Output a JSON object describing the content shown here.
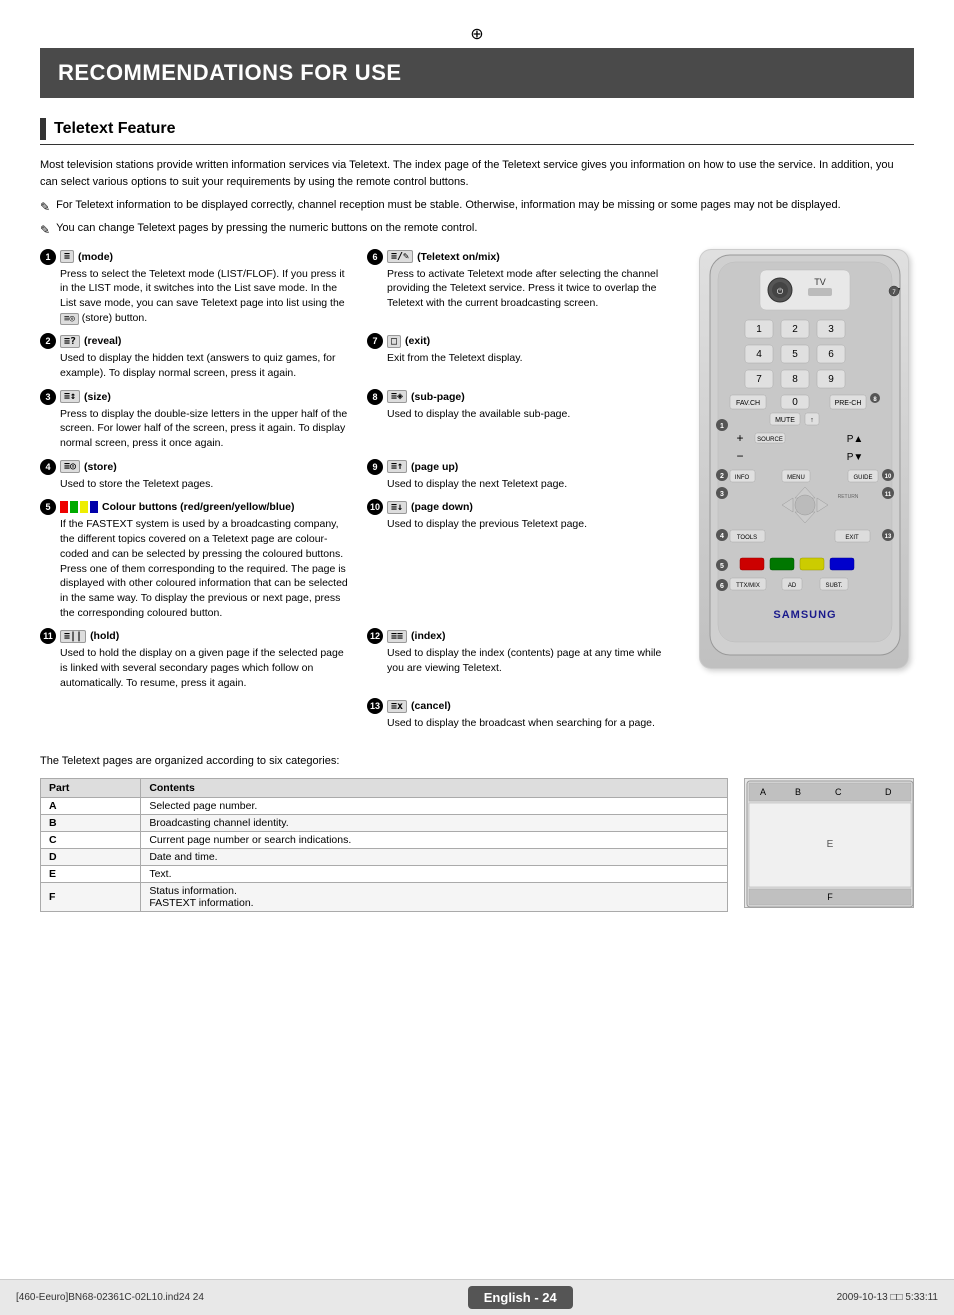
{
  "page": {
    "title": "RECOMMENDATIONS FOR USE",
    "section": "Teletext Feature",
    "intro": "Most television stations provide written information services via Teletext. The index page of the Teletext service gives you information on how to use the service. In addition, you can select various options to suit your requirements by using the remote control buttons.",
    "notes": [
      "For Teletext information to be displayed correctly, channel reception must be stable. Otherwise, information may be missing or some pages may not be displayed.",
      "You can change Teletext pages by pressing the numeric buttons on the remote control."
    ],
    "items": [
      {
        "num": "1",
        "icon": "≡",
        "label": "(mode)",
        "desc": "Press to select the Teletext mode (LIST/FLOF). If you press it in the LIST mode, it switches into the List save mode. In the List save mode, you can save Teletext page into list using the  (store) button."
      },
      {
        "num": "6",
        "icon": "≡/✎",
        "label": "(Teletext on/mix)",
        "desc": "Press to activate Teletext mode after selecting the channel providing the Teletext service. Press it twice to overlap the Teletext with the current broadcasting screen."
      },
      {
        "num": "2",
        "icon": "≡?",
        "label": "(reveal)",
        "desc": "Used to display the hidden text (answers to quiz games, for example). To display normal screen, press it again."
      },
      {
        "num": "7",
        "icon": "□",
        "label": "(exit)",
        "desc": "Exit from the Teletext display."
      },
      {
        "num": "3",
        "icon": "≡↕",
        "label": "(size)",
        "desc": "Press to display the double-size letters in the upper half of the screen. For lower half of the screen, press it again. To display normal screen, press it once again."
      },
      {
        "num": "8",
        "icon": "≡◈",
        "label": "(sub-page)",
        "desc": "Used to display the available sub-page."
      },
      {
        "num": "4",
        "icon": "≡◎",
        "label": "(store)",
        "desc": "Used to store the Teletext pages."
      },
      {
        "num": "9",
        "icon": "≡↑",
        "label": "(page up)",
        "desc": "Used to display the next Teletext page."
      },
      {
        "num": "5",
        "icon": "■■■■",
        "label": "Colour buttons (red/green/yellow/blue)",
        "desc": "If the FASTEXT system is used by a broadcasting company, the different topics covered on a Teletext page are colour-coded and can be selected by pressing the coloured buttons. Press one of them corresponding to the required. The page is displayed with other coloured information that can be selected in the same way. To display the previous or next page, press the corresponding coloured button."
      },
      {
        "num": "10",
        "icon": "≡↓",
        "label": "(page down)",
        "desc": "Used to display the previous Teletext page."
      },
      {
        "num": "11",
        "icon": "≡||",
        "label": "(hold)",
        "desc": "Used to hold the display on a given page if the selected page is linked with several secondary pages which follow on automatically. To resume, press it again."
      },
      {
        "num": "12",
        "icon": "≡≡",
        "label": "(index)",
        "desc": "Used to display the index (contents) page at any time while you are viewing Teletext."
      },
      {
        "num": "13",
        "icon": "≡x",
        "label": "(cancel)",
        "desc": "Used to display the broadcast when searching for a page."
      }
    ],
    "table_intro": "The Teletext pages are organized according to six categories:",
    "table": {
      "headers": [
        "Part",
        "Contents"
      ],
      "rows": [
        [
          "A",
          "Selected page number."
        ],
        [
          "B",
          "Broadcasting channel identity."
        ],
        [
          "C",
          "Current page number or search indications."
        ],
        [
          "D",
          "Date and time."
        ],
        [
          "E",
          "Text."
        ],
        [
          "F",
          "Status information.\nFASTEXT information."
        ]
      ]
    },
    "footer": {
      "left": "[460-Eeuro]BN68-02361C-02L10.ind24   24",
      "center": "English - 24",
      "right": "2009-10-13   □□ 5:33:11"
    }
  }
}
